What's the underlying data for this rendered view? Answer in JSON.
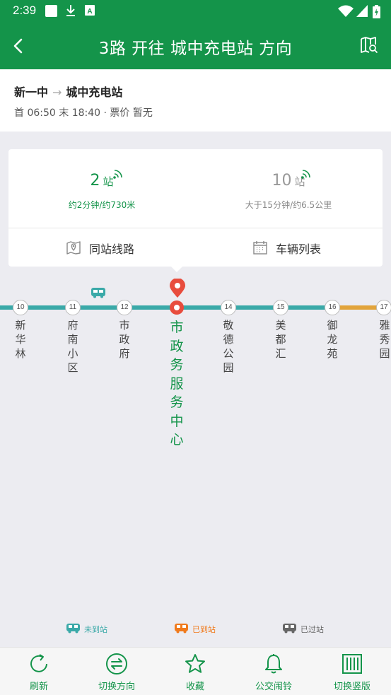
{
  "status_bar": {
    "time": "2:39"
  },
  "header": {
    "title": "3路 开往 城中充电站 方向"
  },
  "route": {
    "from": "新一中",
    "arrow": "→",
    "to": "城中充电站",
    "schedule": "首 06:50 末 18:40 · 票价 暂无"
  },
  "arrivals": [
    {
      "stops": "2",
      "unit": "站",
      "detail": "约2分钟/约730米"
    },
    {
      "stops": "10",
      "unit": "站",
      "detail": "大于15分钟/约6.5公里"
    }
  ],
  "actions": {
    "same_station_lines": "同站线路",
    "vehicle_list": "车辆列表"
  },
  "stations": [
    {
      "num": "10",
      "name": "新华林"
    },
    {
      "num": "11",
      "name": "府南小区"
    },
    {
      "num": "12",
      "name": "市政府"
    },
    {
      "num": "13",
      "name": "市政务服务中心",
      "current": true
    },
    {
      "num": "14",
      "name": "敬德公园"
    },
    {
      "num": "15",
      "name": "美都汇"
    },
    {
      "num": "16",
      "name": "御龙苑"
    },
    {
      "num": "17",
      "name": "雅秀园"
    }
  ],
  "legend": {
    "not_arrived": "未到站",
    "arrived": "已到站",
    "passed": "已过站"
  },
  "bottom_nav": {
    "refresh": "刷新",
    "switch_direction": "切换方向",
    "favorite": "收藏",
    "bus_alarm": "公交闹铃",
    "switch_vertical": "切换竖版"
  },
  "colors": {
    "brand": "#14944a",
    "line": "#3aa9a8",
    "congested": "#e2a43b",
    "current_stop": "#e84c3d",
    "arrived": "#f07a1c",
    "passed": "#666666"
  },
  "icons": [
    "back-icon",
    "route-map-icon",
    "signal-icon",
    "map-pin-icon",
    "calendar-icon",
    "bus-icon",
    "refresh-icon",
    "swap-icon",
    "star-icon",
    "bell-icon",
    "vertical-layout-icon"
  ]
}
